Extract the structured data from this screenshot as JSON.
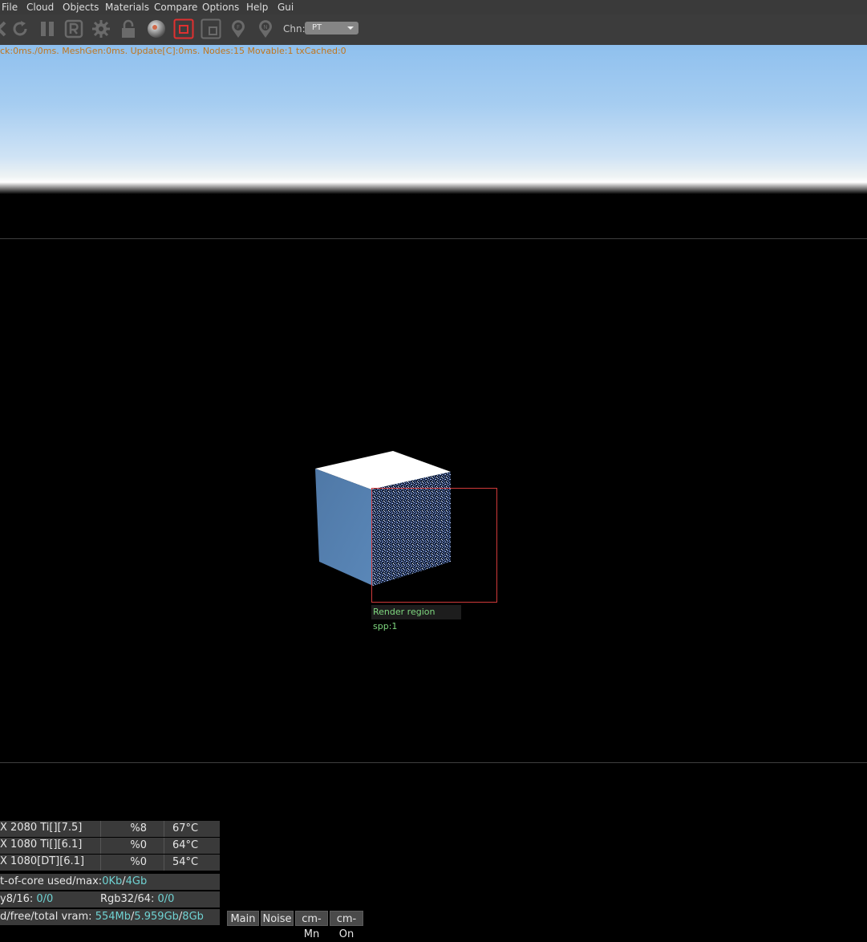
{
  "menu": [
    "File",
    "Cloud",
    "Objects",
    "Materials",
    "Compare",
    "Options",
    "Help",
    "Gui"
  ],
  "toolbar": {
    "icons": [
      "stop-icon",
      "restart-icon",
      "pause-icon",
      "r-icon",
      "gear-icon",
      "lock-icon",
      "material-ball-icon",
      "render-region-icon",
      "region-frame-icon",
      "pin-f-icon",
      "pin-n-icon"
    ],
    "channel_label": "Chn:",
    "channel_value": "PT",
    "active_color": "#e03030"
  },
  "stats_line": "ck:0ms./0ms. MeshGen:0ms. Update[C]:0ms. Nodes:15 Movable:1 txCached:0",
  "render_region_label": "Render region spp:1",
  "gpus": [
    {
      "name": "X 2080 Ti[][7.5]",
      "usage": "%8",
      "temp": "67°C"
    },
    {
      "name": "X 1080 Ti[][6.1]",
      "usage": "%0",
      "temp": "64°C"
    },
    {
      "name": "X 1080[DT][6.1]",
      "usage": "%0",
      "temp": "54°C"
    }
  ],
  "out_of_core": {
    "label": "t-of-core used/max:",
    "used": "0Kb",
    "sep": "/",
    "max": "4Gb"
  },
  "textures": {
    "label1": "y8/16: ",
    "value1": "0/0",
    "label2": "Rgb32/64: ",
    "value2": "0/0"
  },
  "vram": {
    "label": "d/free/total vram: ",
    "used": "554Mb",
    "free": "5.959Gb",
    "total": "8Gb"
  },
  "mode_buttons": [
    "Main",
    "Noise",
    "cm-Mn",
    "cm-On"
  ]
}
